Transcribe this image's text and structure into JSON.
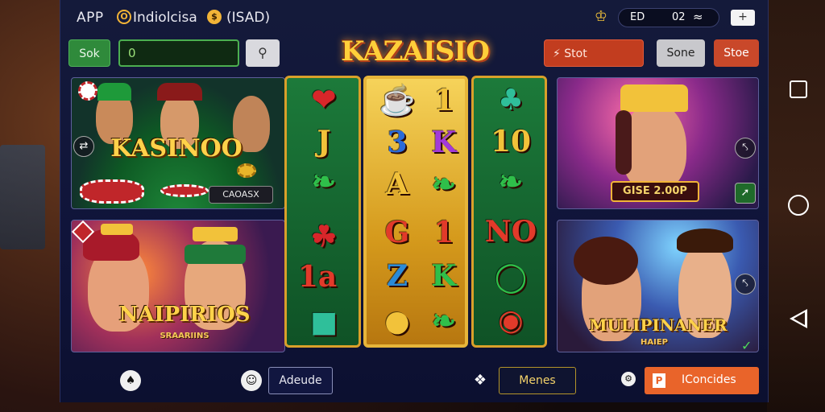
{
  "status_bar": {
    "app_label": "APP",
    "brand_icon": "O",
    "brand_title": "Indiolcisa",
    "brand_icon2": "$",
    "brand_suffix": "(ISAD)",
    "time": "ED",
    "battery": "02",
    "menu_button": "+"
  },
  "controls": {
    "sok_label": "Sok",
    "amount_value": "0",
    "search_icon": "search-icon",
    "logo": "KAZAISIO",
    "slot_label": "Stot",
    "sone_label": "Sone",
    "stoe_label": "Stoe"
  },
  "tiles": [
    {
      "title": "KASINOO",
      "chip_button": "CAOASX"
    },
    {
      "title": "NAIPIRIOS",
      "subtitle": "SRAARIINS"
    },
    {
      "amount": "GISE 2.00P"
    },
    {
      "title": "MULIPINANER",
      "subtitle": "HAIEP"
    }
  ],
  "reels": {
    "left": [
      "J",
      "1a"
    ],
    "middle": [
      "1",
      "3",
      "K",
      "A",
      "G",
      "1",
      "Z",
      "K"
    ],
    "right": [
      "10",
      "NO"
    ]
  },
  "bottom_bar": {
    "accounts_label": "Adeude",
    "menus_label": "Menes",
    "contacts_label": "IConcides",
    "contacts_icon": "P"
  },
  "colors": {
    "accent_gold": "#f2b437",
    "accent_red": "#c23d1f",
    "accent_green": "#2f8a3b",
    "orange": "#e9642a"
  }
}
